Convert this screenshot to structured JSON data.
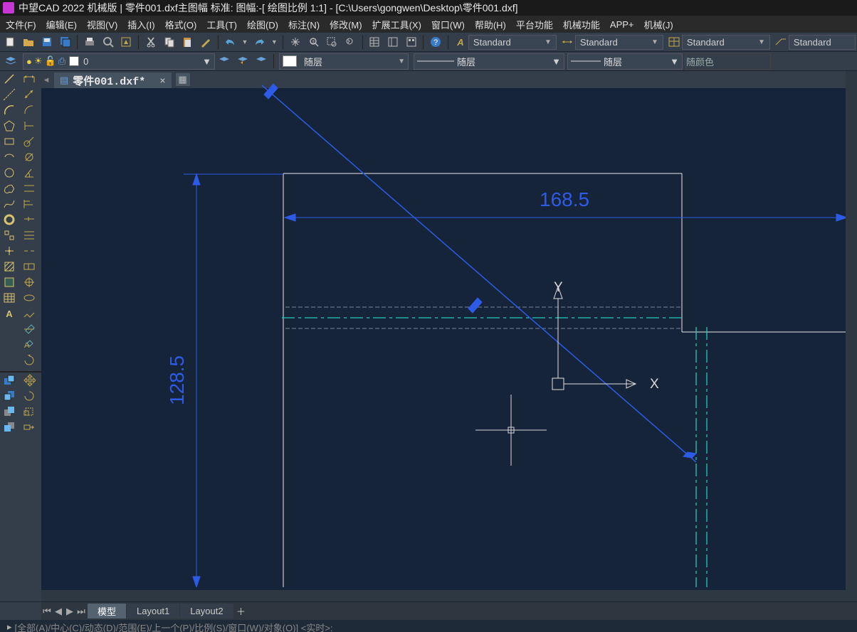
{
  "title_bar": {
    "text": "中望CAD 2022 机械版 | 零件001.dxf主图幅  标准: 图幅:-[ 绘图比例 1:1] - [C:\\Users\\gongwen\\Desktop\\零件001.dxf]"
  },
  "menu": {
    "items": [
      "文件(F)",
      "编辑(E)",
      "视图(V)",
      "插入(I)",
      "格式(O)",
      "工具(T)",
      "绘图(D)",
      "标注(N)",
      "修改(M)",
      "扩展工具(X)",
      "窗口(W)",
      "帮助(H)",
      "平台功能",
      "机械功能",
      "APP+",
      "机械(J)"
    ]
  },
  "toolbar1": {
    "style_dropdowns": [
      {
        "icon": "text",
        "value": "Standard"
      },
      {
        "icon": "dim",
        "value": "Standard"
      },
      {
        "icon": "table",
        "value": "Standard"
      },
      {
        "icon": "mleader",
        "value": "Standard"
      }
    ]
  },
  "toolbar2": {
    "layer_current": "0",
    "layer_ctrl": "随层",
    "linetype": "随层",
    "lineweight": "随层",
    "color_label": "随颜色"
  },
  "file_tabs": {
    "active": "零件001.dxf*"
  },
  "drawing": {
    "dim_width": "168.5",
    "dim_height": "128.5",
    "axis_x": "X",
    "axis_y": "Y"
  },
  "layout_tabs": {
    "active": "模型",
    "others": [
      "Layout1",
      "Layout2"
    ]
  },
  "command_line": {
    "text": "[全部(A)/中心(C)/动态(D)/范围(E)/上一个(P)/比例(S)/窗口(W)/对象(O)] <实时>:"
  },
  "colors": {
    "accent_blue": "#2d5be8",
    "canvas_bg": "#16243a",
    "cyan": "#1fc9b8"
  },
  "chart_data": {
    "type": "table",
    "note": "CAD drawing view, not a data chart"
  }
}
